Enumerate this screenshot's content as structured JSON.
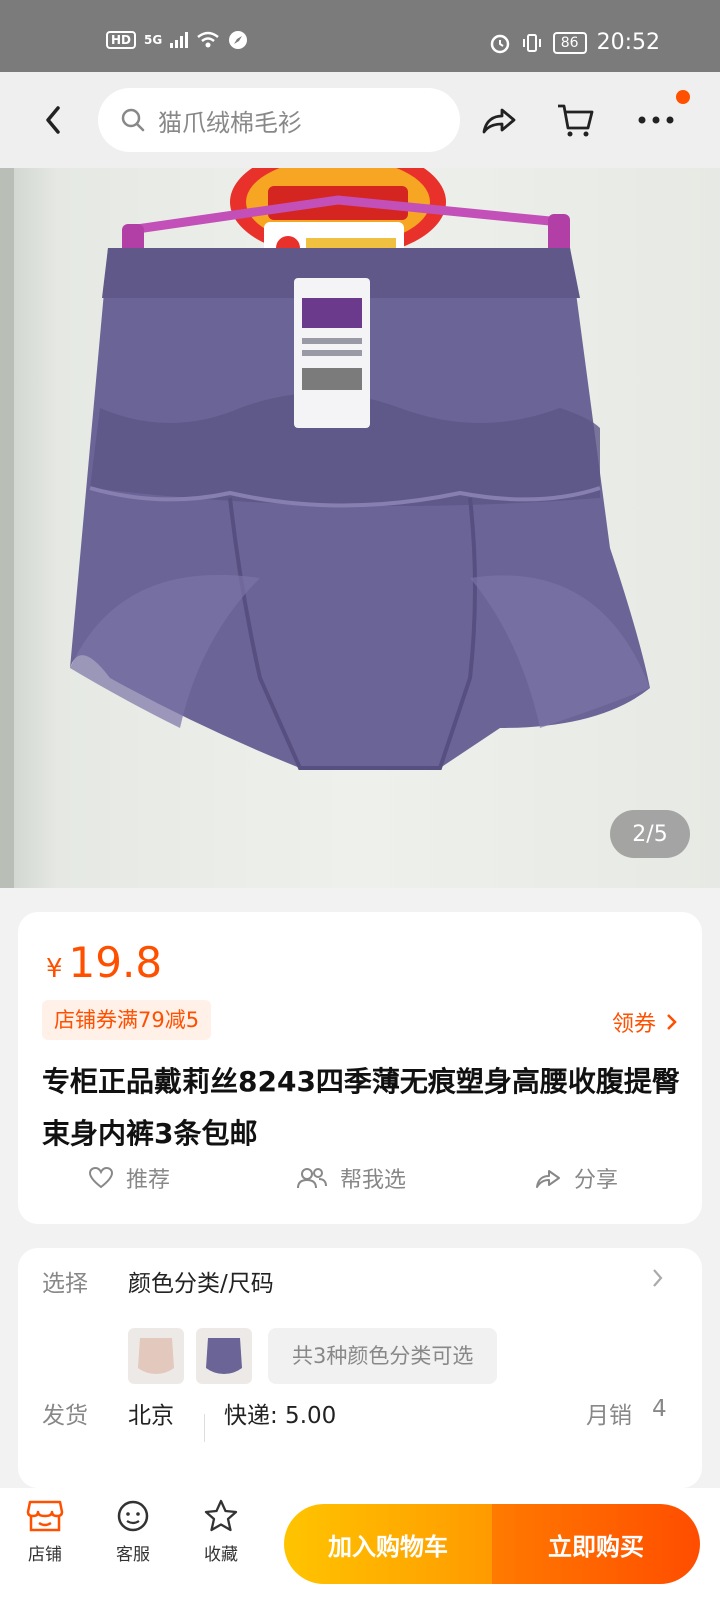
{
  "status_bar": {
    "hd": "HD",
    "network": "5G",
    "battery": "86",
    "time": "20:52"
  },
  "top_bar": {
    "search_placeholder": "猫爪绒棉毛衫"
  },
  "gallery": {
    "pager": "2/5"
  },
  "product": {
    "currency": "¥",
    "price": "19.8",
    "coupon": "店铺券满79减5",
    "get_coupon": "领券",
    "title": "专柜正品戴莉丝8243四季薄无痕塑身高腰收腹提臀束身内裤3条包邮",
    "actions": {
      "recommend": "推荐",
      "help_choose": "帮我选",
      "share": "分享"
    }
  },
  "options": {
    "select_label": "选择",
    "select_value": "颜色分类/尺码",
    "variants_chip": "共3种颜色分类可选",
    "ship_label": "发货",
    "ship_city": "北京",
    "ship_fee": "快递: 5.00",
    "sales_label": "月销",
    "sales_value": "4"
  },
  "bottom_bar": {
    "store": "店铺",
    "service": "客服",
    "favorite": "收藏",
    "add_cart": "加入购物车",
    "buy_now": "立即购买"
  },
  "colors": {
    "accent": "#ff5000",
    "cart_button": "#ffb300",
    "buy_button": "#ff5a00",
    "product": "#6b6496"
  }
}
